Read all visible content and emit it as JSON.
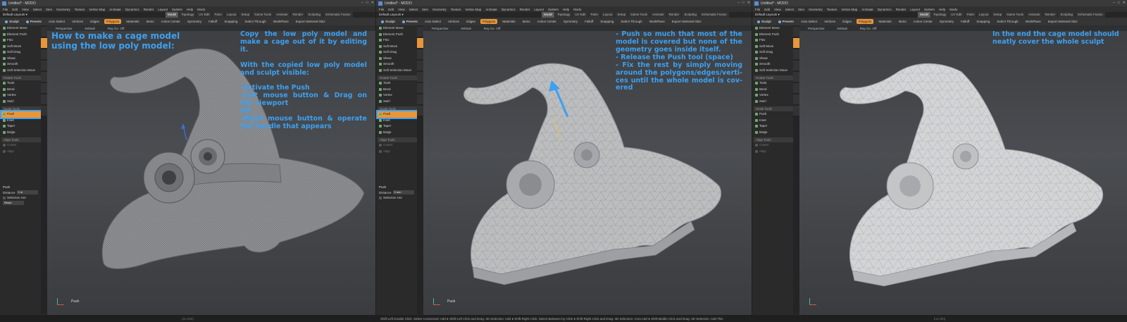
{
  "app": {
    "window_title": "Untitled* - MODO",
    "window_controls": [
      "–",
      "□",
      "✕"
    ],
    "menu": [
      "File",
      "Edit",
      "View",
      "Select",
      "Item",
      "Geometry",
      "Texture",
      "Vertex Map",
      "Animate",
      "Dynamics",
      "Render",
      "Layout",
      "System",
      "Help",
      "Modo"
    ],
    "layout_select": "Default Layouts ▾",
    "layout_tabs": [
      "Model",
      "Topology",
      "UV Edit",
      "Paint",
      "Layout",
      "Setup",
      "Game Tools",
      "Animate",
      "Render",
      "Scripting",
      "Schematic Fusion"
    ],
    "active_layout_tab": "Model",
    "toolbar": [
      "Sculpt",
      "Presets",
      "Auto Select",
      "Vertices",
      "Edges",
      "Polygons",
      "Materials",
      "Items",
      "Action Center",
      "Symmetry",
      "Falloff",
      "Snapping",
      "Select Through",
      "WorkPlane",
      "Export Selected OBJ"
    ],
    "active_toolbar": "Polygons",
    "accent_color": "#e8963a",
    "annotation_color": "#3ea0f0"
  },
  "toolbox": {
    "deform_head": "",
    "deform": [
      "Element Move",
      "Element Push",
      "Flex",
      "Soft Move",
      "Soft Drag",
      "Shear",
      "Smooth",
      "Soft Selection Move"
    ],
    "rotate_head": "Rotate Tools",
    "rotate": [
      "Twist",
      "Bend",
      "Vortex",
      "Swirl"
    ],
    "scale_head": "Scale Tools",
    "scale": [
      "Push",
      "Inset",
      "Taper",
      "Bulge"
    ],
    "align_head": "Align Tools",
    "align": [
      "Center",
      "Align"
    ],
    "highlighted": "Push"
  },
  "properties": {
    "title": "Push",
    "distance_label": "Distance",
    "panel1_distance": "0 m",
    "panel2_distance": "5 mm",
    "selection_label": "Selection Hor",
    "apply_label": "Reset"
  },
  "viewport": {
    "view_name": "Perspective",
    "shading": "Default",
    "ray": "Ray GL: Off",
    "tool_name": "Push",
    "info": "(no info)"
  },
  "panel1": {
    "overlay_left": "How to make a cage model\nusing the low poly model:",
    "overlay_right": "Copy the low poly model and make a cage out of it by editing it.\n\nWith the copied low poly model and sculpt visible:\n\n-Activate the Push\n-Left mouse button & Drag on the viewport\nOR\n-Right mouse button & operate the handle that appears"
  },
  "panel2": {
    "overlay": "- Push so much that most of the model is covered but none of the geometry goes inside itself.\n- Release the Push tool (space)\n- Fix the rest by simply moving around the polygons/edges/verti-ces until the whole model is cov-ered",
    "statusbar": "Shift-Left Double Click: Select Connected: Add ● Shift-Left Click and Drag: 3D Selection: Add ● Shift-Right Click: Select Between by Click ● Shift-Right Click and Drag: 3D Selection: Area Add ● Shift-Middle Click and Drag: 3D Selection: Add This"
  },
  "panel3": {
    "overlay": "In the end the cage model should neatly cover the whole sculpt"
  }
}
